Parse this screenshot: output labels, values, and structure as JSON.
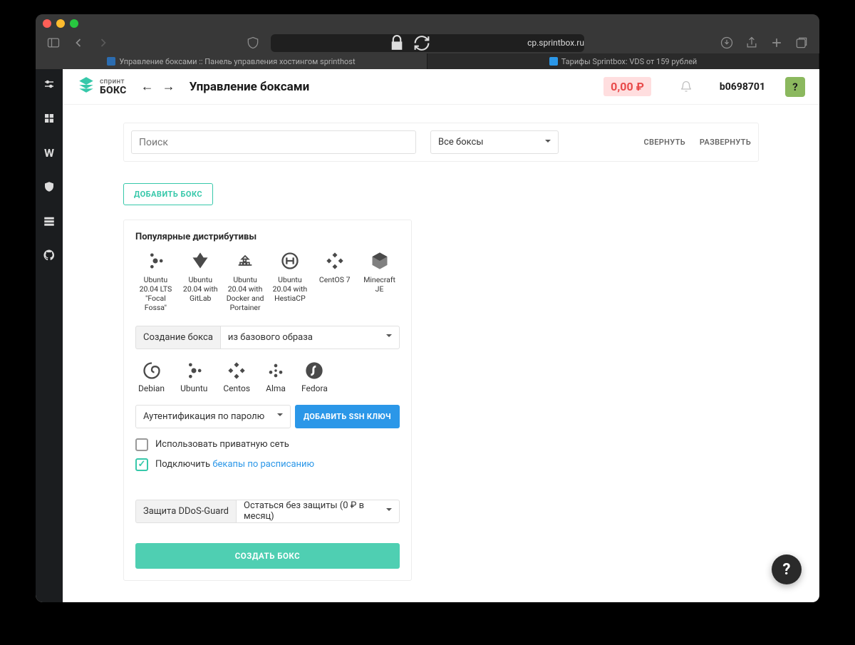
{
  "browser": {
    "url": "cp.sprintbox.ru",
    "tabs": [
      {
        "label": "Управление боксами :: Панель управления хостингом sprinthost",
        "active": true
      },
      {
        "label": "Тарифы Sprintbox: VDS от 159 рублей",
        "active": false
      }
    ]
  },
  "header": {
    "logo_line1": "спринт",
    "logo_line2": "БОКС",
    "title": "Управление боксами",
    "balance": "0,00 ₽",
    "username": "b0698701",
    "avatar": "?"
  },
  "search": {
    "placeholder": "Поиск",
    "filter": "Все боксы",
    "collapse": "СВЕРНУТЬ",
    "expand": "РАЗВЕРНУТЬ"
  },
  "add_box_label": "ДОБАВИТЬ БОКС",
  "panel": {
    "distros_title": "Популярные дистрибутивы",
    "distros": [
      {
        "label": "Ubuntu 20.04 LTS \"Focal Fossa\""
      },
      {
        "label": "Ubuntu 20.04 with GitLab"
      },
      {
        "label": "Ubuntu 20.04 with Docker and Portainer"
      },
      {
        "label": "Ubuntu 20.04 with HestiaCP"
      },
      {
        "label": "CentOS 7"
      },
      {
        "label": "Minecraft JE"
      }
    ],
    "create_label": "Создание бокса",
    "create_value": "из базового образа",
    "os_list": [
      {
        "label": "Debian"
      },
      {
        "label": "Ubuntu"
      },
      {
        "label": "Centos"
      },
      {
        "label": "Alma"
      },
      {
        "label": "Fedora"
      }
    ],
    "auth_value": "Аутентификация по паролю",
    "add_ssh": "ДОБАВИТЬ SSH КЛЮЧ",
    "private_net": "Использовать приватную сеть",
    "backups_prefix": "Подключить ",
    "backups_link": "бекапы по расписанию",
    "ddos_label": "Защита DDoS-Guard",
    "ddos_value": "Остаться без защиты (0 ₽ в месяц)",
    "create_btn": "СОЗДАТЬ БОКС"
  }
}
